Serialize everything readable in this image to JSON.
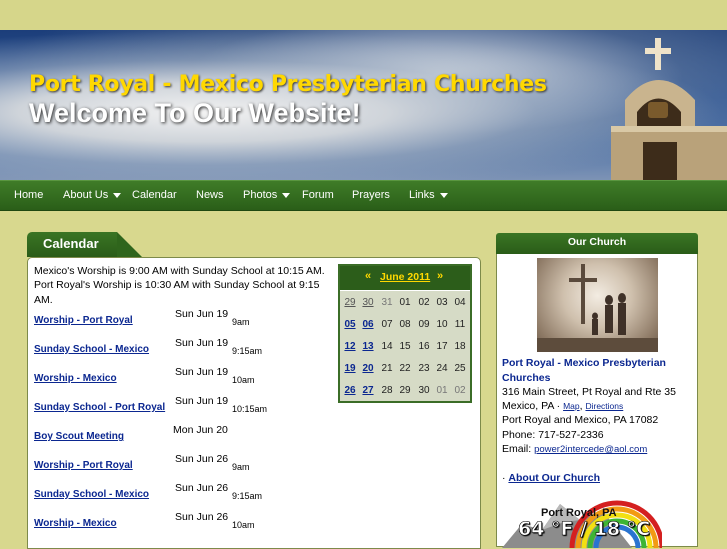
{
  "header": {
    "title": "Port Royal - Mexico Presbyterian Churches",
    "subtitle": "Welcome To Our Website!"
  },
  "nav": {
    "items": [
      {
        "label": "Home",
        "dropdown": false
      },
      {
        "label": "About Us",
        "dropdown": true
      },
      {
        "label": "Calendar",
        "dropdown": false
      },
      {
        "label": "News",
        "dropdown": false
      },
      {
        "label": "Photos",
        "dropdown": true
      },
      {
        "label": "Forum",
        "dropdown": false
      },
      {
        "label": "Prayers",
        "dropdown": false
      },
      {
        "label": "Links",
        "dropdown": true
      }
    ]
  },
  "calendar_panel": {
    "title": "Calendar",
    "worship_text": "Mexico's Worship is 9:00 AM with Sunday School at 10:15 AM. Port Royal's Worship is 10:30 AM with Sunday School at 9:15 AM.",
    "events": [
      {
        "title": "Worship - Port Royal",
        "date": "Sun Jun 19",
        "time": "9am"
      },
      {
        "title": "Sunday School - Mexico",
        "date": "Sun Jun 19",
        "time": "9:15am"
      },
      {
        "title": "Worship - Mexico",
        "date": "Sun Jun 19",
        "time": "10am"
      },
      {
        "title": "Sunday School - Port Royal",
        "date": "Sun Jun 19",
        "time": "10:15am"
      },
      {
        "title": "Boy Scout Meeting",
        "date": "Mon Jun 20",
        "time": ""
      },
      {
        "title": "Worship - Port Royal",
        "date": "Sun Jun 26",
        "time": "9am"
      },
      {
        "title": "Sunday School - Mexico",
        "date": "Sun Jun 26",
        "time": "9:15am"
      },
      {
        "title": "Worship - Mexico",
        "date": "Sun Jun 26",
        "time": "10am"
      }
    ]
  },
  "mini_calendar": {
    "month": "June 2011",
    "prev": "«",
    "next": "»",
    "weeks": [
      [
        "29",
        "30",
        "31",
        "01",
        "02",
        "03",
        "04"
      ],
      [
        "05",
        "06",
        "07",
        "08",
        "09",
        "10",
        "11"
      ],
      [
        "12",
        "13",
        "14",
        "15",
        "16",
        "17",
        "18"
      ],
      [
        "19",
        "20",
        "21",
        "22",
        "23",
        "24",
        "25"
      ],
      [
        "26",
        "27",
        "28",
        "29",
        "30",
        "01",
        "02"
      ]
    ]
  },
  "sidebar": {
    "title": "Our Church",
    "church_name": "Port Royal - Mexico Presbyterian Churches",
    "address1": "316 Main Street, Pt Royal and Rte 35",
    "address2_prefix": "Mexico, PA · ",
    "map_label": "Map",
    "directions_label": "Directions",
    "address3": "Port Royal and Mexico, PA 17082",
    "phone": "Phone: 717-527-2336",
    "email_prefix": "Email: ",
    "email": "power2intercede@aol.com",
    "about_prefix": "· ",
    "about_label": "About Our Church",
    "weather_place": "Port Royal, PA",
    "weather_temp": "64 °F / 18 °C"
  },
  "colors": {
    "page_bg": "#d8d88e",
    "nav_bg": "#2f651c",
    "title_yellow": "#ffd800",
    "link_blue": "#0b2790"
  }
}
